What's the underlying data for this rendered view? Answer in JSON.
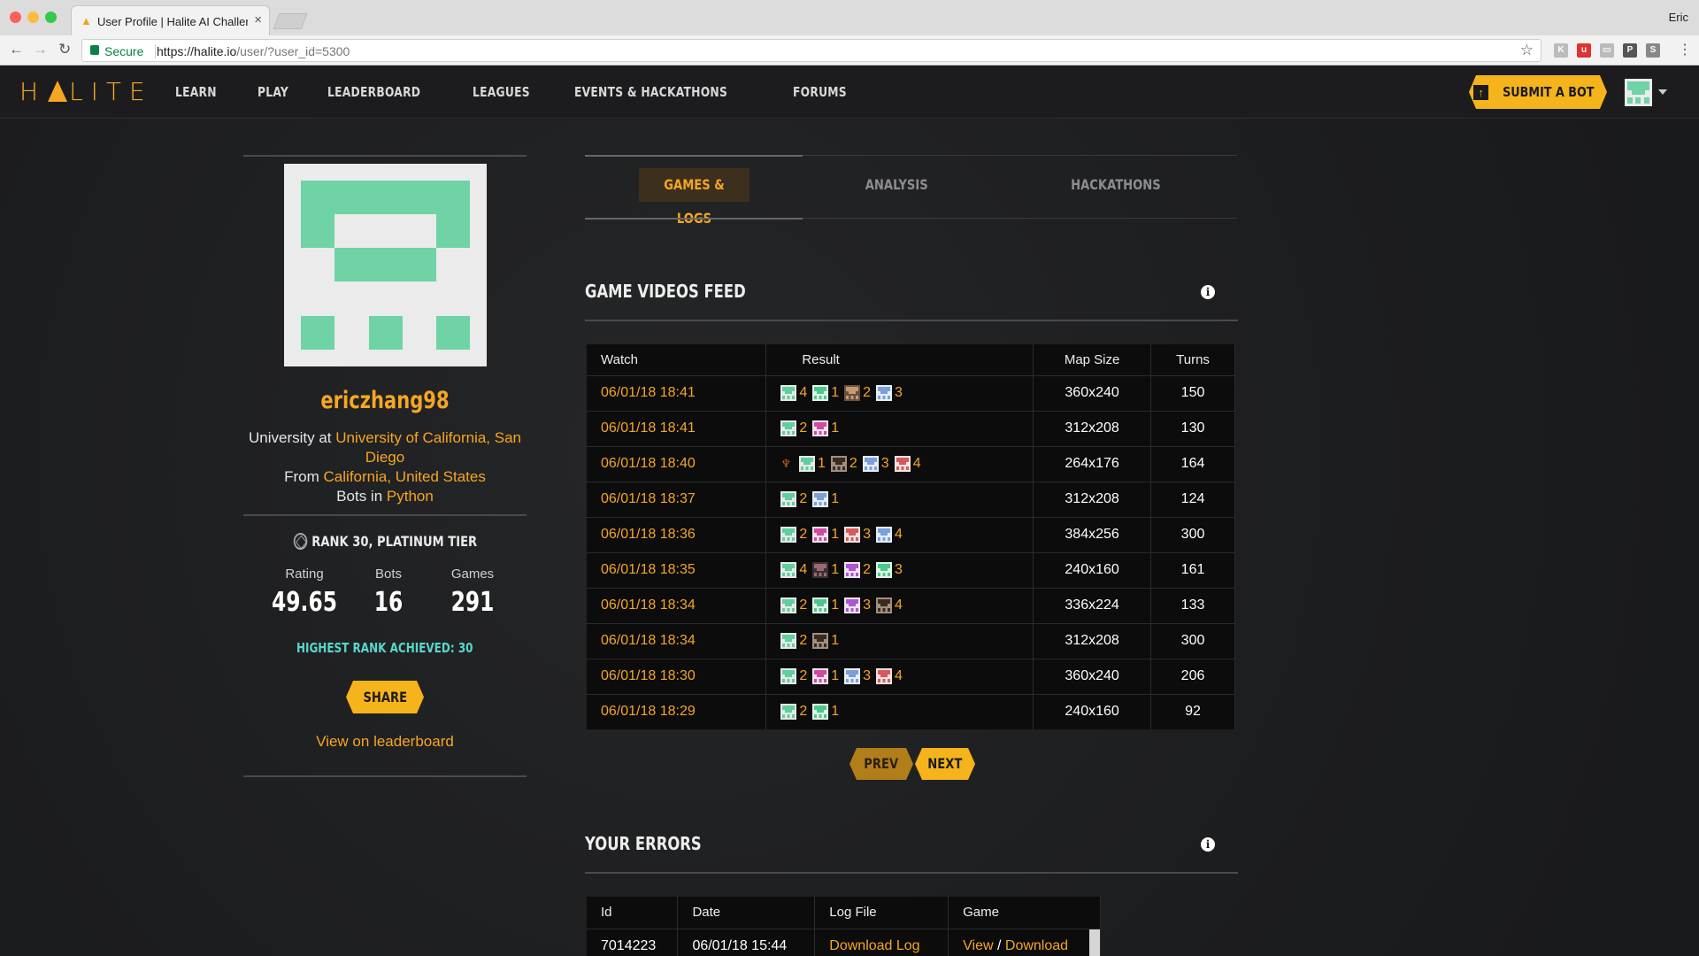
{
  "browser": {
    "tab_title": "User Profile | Halite AI Challenge",
    "user": "Eric",
    "secure_label": "Secure",
    "url_host": "https://halite.io",
    "url_rest": "/user/?user_id=5300"
  },
  "header": {
    "logo": "LITE",
    "logo_prefix": "H",
    "nav": [
      "LEARN",
      "PLAY",
      "LEADERBOARD",
      "LEAGUES",
      "EVENTS & HACKATHONS",
      "FORUMS"
    ],
    "submit_label": "SUBMIT A BOT"
  },
  "profile": {
    "username": "ericzhang98",
    "university_prefix": "University at",
    "university": "University of California, San Diego",
    "from_prefix": "From",
    "location": "California, United States",
    "bots_prefix": "Bots in",
    "language": "Python",
    "rank_text": "RANK 30, PLATINUM TIER",
    "stats": [
      {
        "label": "Rating",
        "value": "49.65"
      },
      {
        "label": "Bots",
        "value": "16"
      },
      {
        "label": "Games",
        "value": "291"
      }
    ],
    "highest_rank": "HIGHEST RANK ACHIEVED: 30",
    "share_label": "SHARE",
    "leaderboard_link": "View on leaderboard"
  },
  "tabs": [
    {
      "label": "GAMES & LOGS",
      "active": true
    },
    {
      "label": "ANALYSIS",
      "active": false
    },
    {
      "label": "HACKATHONS",
      "active": false
    }
  ],
  "games_section": {
    "title": "GAME VIDEOS FEED",
    "headers": [
      "Watch",
      "Result",
      "Map Size",
      "Turns"
    ],
    "rows": [
      {
        "watch": "06/01/18 18:41",
        "trophy": false,
        "result": [
          [
            "green",
            "4"
          ],
          [
            "mint",
            "1"
          ],
          [
            "photo",
            "2"
          ],
          [
            "blue",
            "3"
          ]
        ],
        "map": "360x240",
        "turns": "150"
      },
      {
        "watch": "06/01/18 18:41",
        "trophy": false,
        "result": [
          [
            "green",
            "2"
          ],
          [
            "pink",
            "1"
          ]
        ],
        "map": "312x208",
        "turns": "130"
      },
      {
        "watch": "06/01/18 18:40",
        "trophy": true,
        "result": [
          [
            "green",
            "1"
          ],
          [
            "photo2",
            "2"
          ],
          [
            "blue",
            "3"
          ],
          [
            "red",
            "4"
          ]
        ],
        "map": "264x176",
        "turns": "164"
      },
      {
        "watch": "06/01/18 18:37",
        "trophy": false,
        "result": [
          [
            "green",
            "2"
          ],
          [
            "blue",
            "1"
          ]
        ],
        "map": "312x208",
        "turns": "124"
      },
      {
        "watch": "06/01/18 18:36",
        "trophy": false,
        "result": [
          [
            "green",
            "2"
          ],
          [
            "pink",
            "1"
          ],
          [
            "red",
            "3"
          ],
          [
            "blue",
            "4"
          ]
        ],
        "map": "384x256",
        "turns": "300"
      },
      {
        "watch": "06/01/18 18:35",
        "trophy": false,
        "result": [
          [
            "green",
            "4"
          ],
          [
            "photo3",
            "1"
          ],
          [
            "purple",
            "2"
          ],
          [
            "mint",
            "3"
          ]
        ],
        "map": "240x160",
        "turns": "161"
      },
      {
        "watch": "06/01/18 18:34",
        "trophy": false,
        "result": [
          [
            "green",
            "2"
          ],
          [
            "mint",
            "1"
          ],
          [
            "purple",
            "3"
          ],
          [
            "photo2",
            "4"
          ]
        ],
        "map": "336x224",
        "turns": "133"
      },
      {
        "watch": "06/01/18 18:34",
        "trophy": false,
        "result": [
          [
            "green",
            "2"
          ],
          [
            "photo2",
            "1"
          ]
        ],
        "map": "312x208",
        "turns": "300"
      },
      {
        "watch": "06/01/18 18:30",
        "trophy": false,
        "result": [
          [
            "green",
            "2"
          ],
          [
            "pink",
            "1"
          ],
          [
            "blue",
            "3"
          ],
          [
            "red",
            "4"
          ]
        ],
        "map": "360x240",
        "turns": "206"
      },
      {
        "watch": "06/01/18 18:29",
        "trophy": false,
        "result": [
          [
            "green",
            "2"
          ],
          [
            "mint",
            "1"
          ]
        ],
        "map": "240x160",
        "turns": "92"
      }
    ],
    "prev_label": "PREV",
    "next_label": "NEXT"
  },
  "errors_section": {
    "title": "YOUR ERRORS",
    "headers": [
      "Id",
      "Date",
      "Log File",
      "Game"
    ],
    "rows": [
      {
        "id": "7014223",
        "date": "06/01/18 15:44",
        "log": "Download Log",
        "view": "View",
        "slash": "/",
        "download": "Download"
      }
    ]
  },
  "colors": {
    "accent": "#f5a623",
    "button": "#f5b41c",
    "avatar_green": "#6fd3a6",
    "highlight_teal": "#5ad6c8"
  }
}
